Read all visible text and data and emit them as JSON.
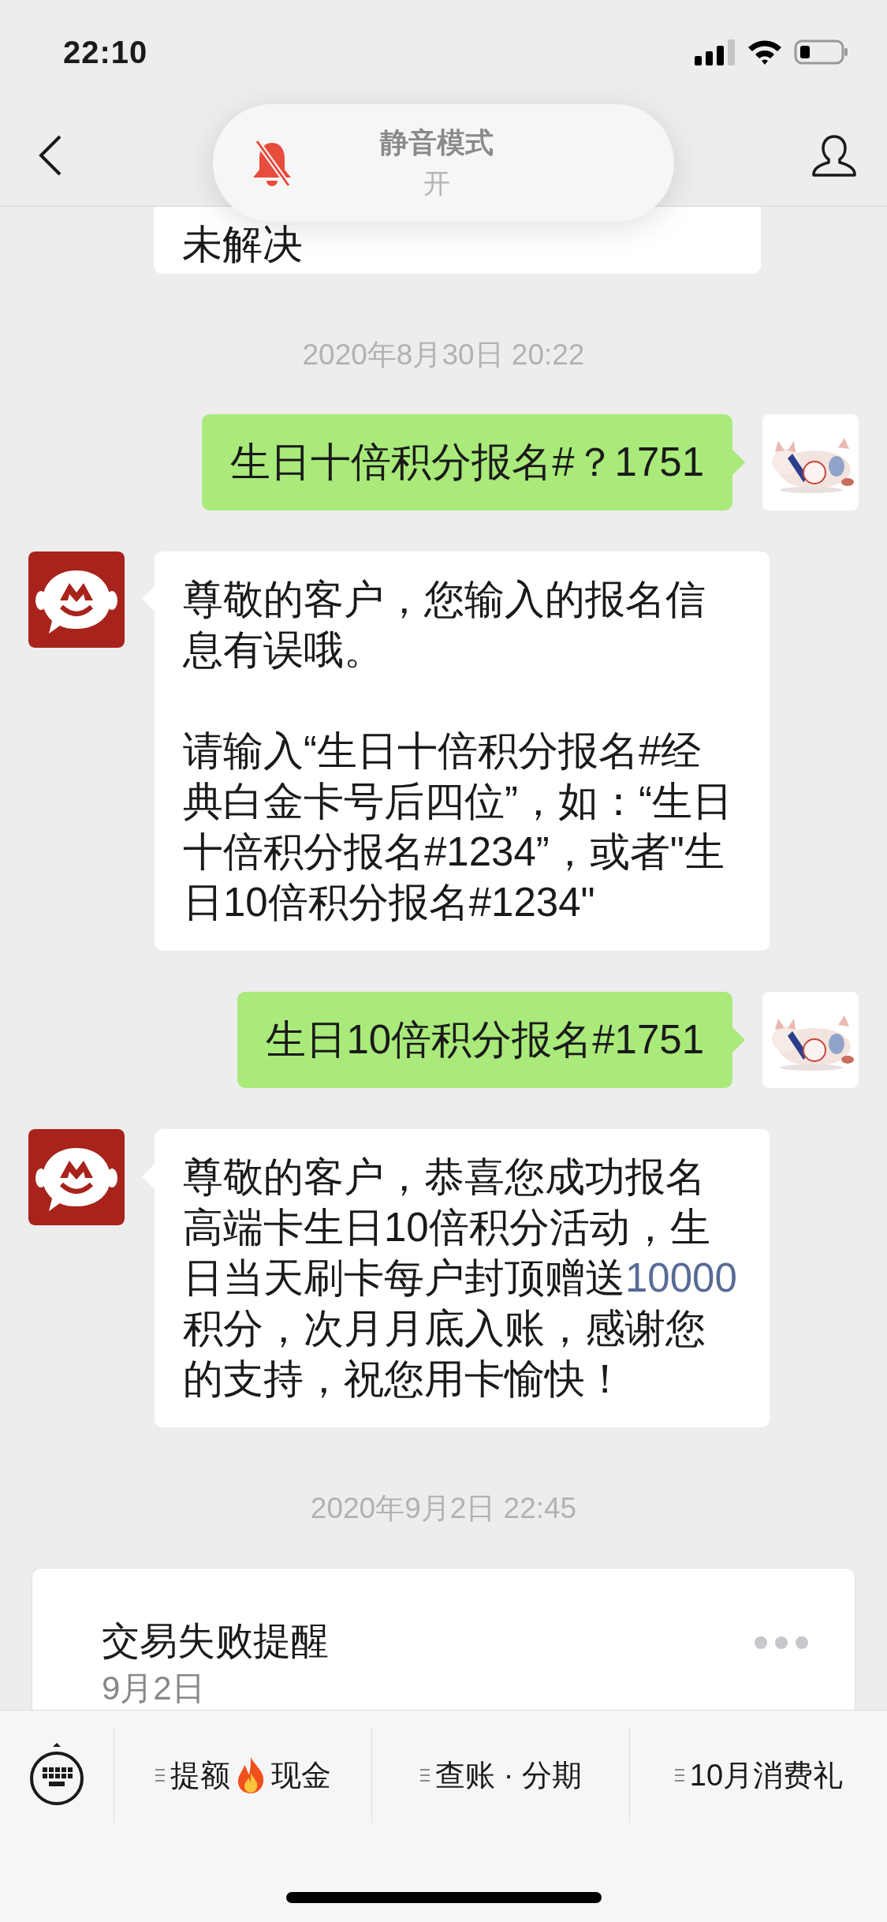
{
  "status_bar": {
    "time": "22:10"
  },
  "mute_banner": {
    "title": "静音模式",
    "state": "开"
  },
  "messages": [
    {
      "kind": "fragment",
      "paragraphs": [
        [
          {
            "kind": "text",
            "text": "未解决"
          }
        ]
      ]
    },
    {
      "kind": "time",
      "text": "2020年8月30日 20:22"
    },
    {
      "kind": "outgoing",
      "paragraphs": [
        [
          {
            "kind": "text",
            "text": "生日十倍积分报名#？1751"
          }
        ]
      ]
    },
    {
      "kind": "incoming",
      "paragraphs": [
        [
          {
            "kind": "text",
            "text": "尊敬的客户，您输入的报名信息有误哦。"
          }
        ],
        [
          {
            "kind": "text",
            "text": "请输入“生日十倍积分报名#经典白金卡号后四位”，如：“生日十倍积分报名#1234”，或者\"生日10倍积分报名#1234\""
          }
        ]
      ]
    },
    {
      "kind": "outgoing",
      "paragraphs": [
        [
          {
            "kind": "text",
            "text": "生日10倍积分报名#1751"
          }
        ]
      ]
    },
    {
      "kind": "incoming",
      "paragraphs": [
        [
          {
            "kind": "text",
            "text": "尊敬的客户，恭喜您成功报名高端卡生日10倍积分活动，生日当天刷卡每户封顶赠送"
          },
          {
            "kind": "link",
            "text": "10000"
          },
          {
            "kind": "text",
            "text": "积分，次月月底入账，感谢您的支持，祝您用卡愉快！"
          }
        ]
      ]
    },
    {
      "kind": "time",
      "text": "2020年9月2日 22:45"
    },
    {
      "kind": "card",
      "title": "交易失败提醒",
      "date": "9月2日"
    }
  ],
  "menu": [
    {
      "label": "提额",
      "label_2": "现金"
    },
    {
      "label": "查账 · 分期"
    },
    {
      "label": "10月消费礼"
    }
  ]
}
